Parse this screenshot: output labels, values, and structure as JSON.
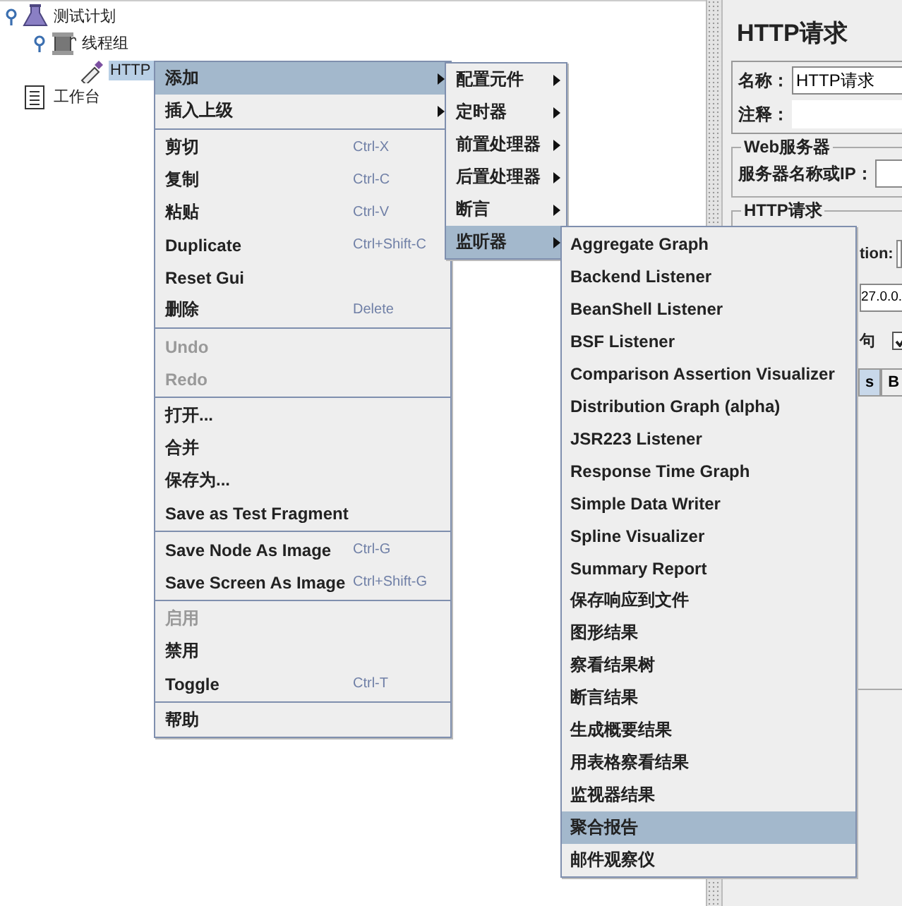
{
  "tree": [
    {
      "label": "测试计划",
      "kind": "test-plan",
      "selected": false,
      "expanded": true,
      "children": [
        {
          "label": "线程组",
          "kind": "thread-group",
          "selected": false,
          "expanded": true,
          "children": [
            {
              "label": "HTTP",
              "kind": "sampler",
              "selected": true
            }
          ]
        }
      ]
    },
    {
      "label": "工作台",
      "kind": "workbench",
      "selected": false
    }
  ],
  "panel": {
    "title": "HTTP请求",
    "name_label": "名称：",
    "name_value": "HTTP请求",
    "comment_label": "注释：",
    "web_server": {
      "legend": "Web服务器",
      "server_label": "服务器名称或IP："
    },
    "http_request": {
      "legend": "HTTP请求",
      "row_1": "tion:",
      "row_2": "27.0.0.",
      "row_3": "句",
      "checked": true
    },
    "tabs": [
      {
        "label": "s",
        "selected": true
      },
      {
        "label": "B",
        "selected": false
      }
    ]
  },
  "menus": [
    {
      "groups": [
        [
          {
            "label": "添加",
            "submenu": true,
            "selected": true,
            "disabled": false
          },
          {
            "label": "插入上级",
            "submenu": true,
            "selected": false,
            "disabled": false
          }
        ],
        [
          {
            "label": "剪切",
            "shortcut": "Ctrl-X",
            "selected": false,
            "disabled": false
          },
          {
            "label": "复制",
            "shortcut": "Ctrl-C",
            "selected": false,
            "disabled": false
          },
          {
            "label": "粘贴",
            "shortcut": "Ctrl-V",
            "selected": false,
            "disabled": false
          },
          {
            "label": "Duplicate",
            "shortcut": "Ctrl+Shift-C",
            "selected": false,
            "disabled": false
          },
          {
            "label": "Reset Gui",
            "selected": false,
            "disabled": false
          },
          {
            "label": "删除",
            "shortcut": "Delete",
            "selected": false,
            "disabled": false
          }
        ],
        [
          {
            "label": "Undo",
            "selected": false,
            "disabled": true
          },
          {
            "label": "Redo",
            "selected": false,
            "disabled": true
          }
        ],
        [
          {
            "label": "打开...",
            "selected": false,
            "disabled": false
          },
          {
            "label": "合并",
            "selected": false,
            "disabled": false
          },
          {
            "label": "保存为...",
            "selected": false,
            "disabled": false
          },
          {
            "label": "Save as Test Fragment",
            "selected": false,
            "disabled": false
          }
        ],
        [
          {
            "label": "Save Node As Image",
            "shortcut": "Ctrl-G",
            "selected": false,
            "disabled": false
          },
          {
            "label": "Save Screen As Image",
            "shortcut": "Ctrl+Shift-G",
            "selected": false,
            "disabled": false
          }
        ],
        [
          {
            "label": "启用",
            "selected": false,
            "disabled": true
          },
          {
            "label": "禁用",
            "selected": false,
            "disabled": false
          },
          {
            "label": "Toggle",
            "shortcut": "Ctrl-T",
            "selected": false,
            "disabled": false
          }
        ],
        [
          {
            "label": "帮助",
            "selected": false,
            "disabled": false
          }
        ]
      ]
    },
    {
      "groups": [
        [
          {
            "label": "配置元件",
            "submenu": true,
            "selected": false
          },
          {
            "label": "定时器",
            "submenu": true,
            "selected": false
          },
          {
            "label": "前置处理器",
            "submenu": true,
            "selected": false
          },
          {
            "label": "后置处理器",
            "submenu": true,
            "selected": false
          },
          {
            "label": "断言",
            "submenu": true,
            "selected": false
          },
          {
            "label": "监听器",
            "submenu": true,
            "selected": true
          }
        ]
      ]
    },
    {
      "groups": [
        [
          {
            "label": "Aggregate Graph",
            "selected": false
          },
          {
            "label": "Backend Listener",
            "selected": false
          },
          {
            "label": "BeanShell Listener",
            "selected": false
          },
          {
            "label": "BSF Listener",
            "selected": false
          },
          {
            "label": "Comparison Assertion Visualizer",
            "selected": false
          },
          {
            "label": "Distribution Graph (alpha)",
            "selected": false
          },
          {
            "label": "JSR223 Listener",
            "selected": false
          },
          {
            "label": "Response Time Graph",
            "selected": false
          },
          {
            "label": "Simple Data Writer",
            "selected": false
          },
          {
            "label": "Spline Visualizer",
            "selected": false
          },
          {
            "label": "Summary Report",
            "selected": false
          },
          {
            "label": "保存响应到文件",
            "selected": false
          },
          {
            "label": "图形结果",
            "selected": false
          },
          {
            "label": "察看结果树",
            "selected": false
          },
          {
            "label": "断言结果",
            "selected": false
          },
          {
            "label": "生成概要结果",
            "selected": false
          },
          {
            "label": "用表格察看结果",
            "selected": false
          },
          {
            "label": "监视器结果",
            "selected": false
          },
          {
            "label": "聚合报告",
            "selected": true
          },
          {
            "label": "邮件观察仪",
            "selected": false
          }
        ]
      ]
    }
  ]
}
